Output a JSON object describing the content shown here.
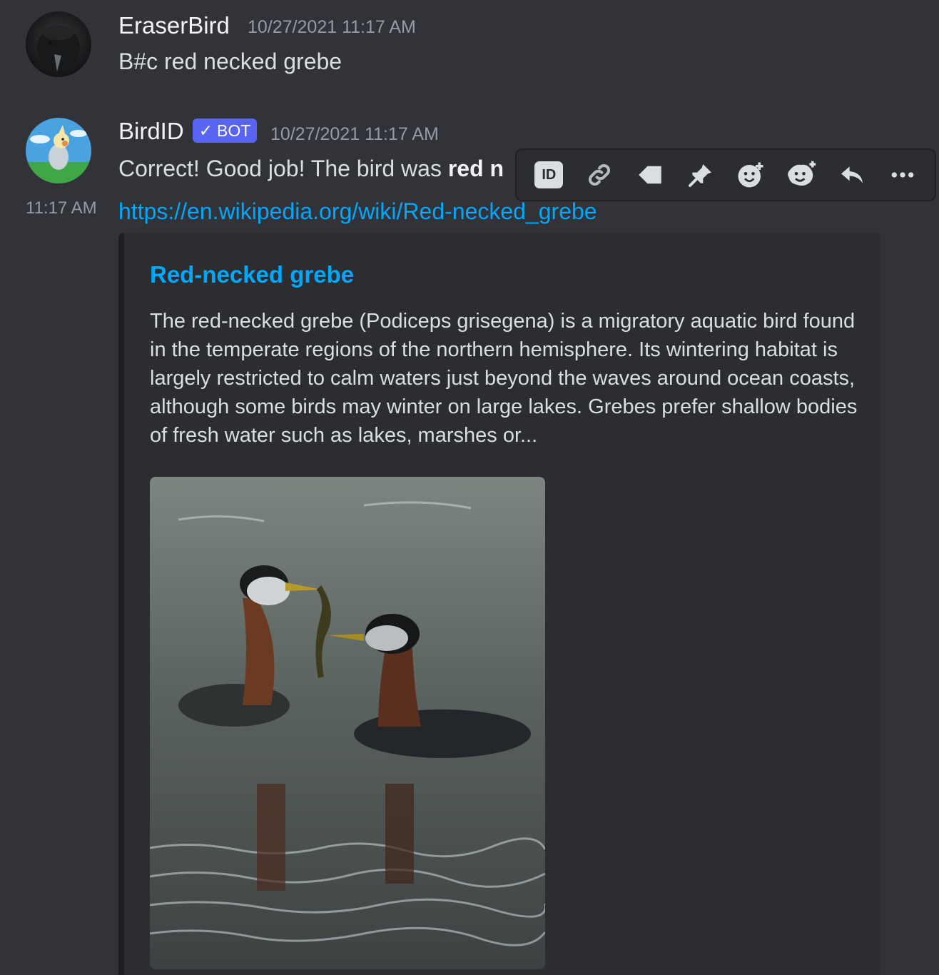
{
  "messages": [
    {
      "username": "EraserBird",
      "timestamp": "10/27/2021 11:17 AM",
      "content": "B#c red necked grebe"
    },
    {
      "username": "BirdID",
      "badge": "BOT",
      "timestamp": "10/27/2021 11:17 AM",
      "content_prefix": "Correct! Good job! The bird was ",
      "content_bold": "red n",
      "hover_time": "11:17 AM",
      "link": "https://en.wikipedia.org/wiki/Red-necked_grebe",
      "embed": {
        "title": "Red-necked grebe",
        "description": "The red-necked grebe (Podiceps grisegena) is a migratory aquatic bird found in the temperate regions of the northern hemisphere. Its wintering habitat is largely restricted to calm waters just beyond the waves around ocean coasts, although some birds may winter on large lakes. Grebes prefer shallow bodies of fresh water such as lakes, marshes or..."
      }
    }
  ],
  "toolbar": {
    "icons": [
      "id-app-icon",
      "link-icon",
      "tag-icon",
      "pin-icon",
      "add-reaction-icon",
      "super-reaction-icon",
      "reply-icon",
      "more-icon"
    ],
    "id_label": "ID"
  },
  "colors": {
    "background": "#313338",
    "bot_badge": "#5865f2",
    "link": "#00a8fc",
    "embed_bg": "#2b2d31"
  }
}
